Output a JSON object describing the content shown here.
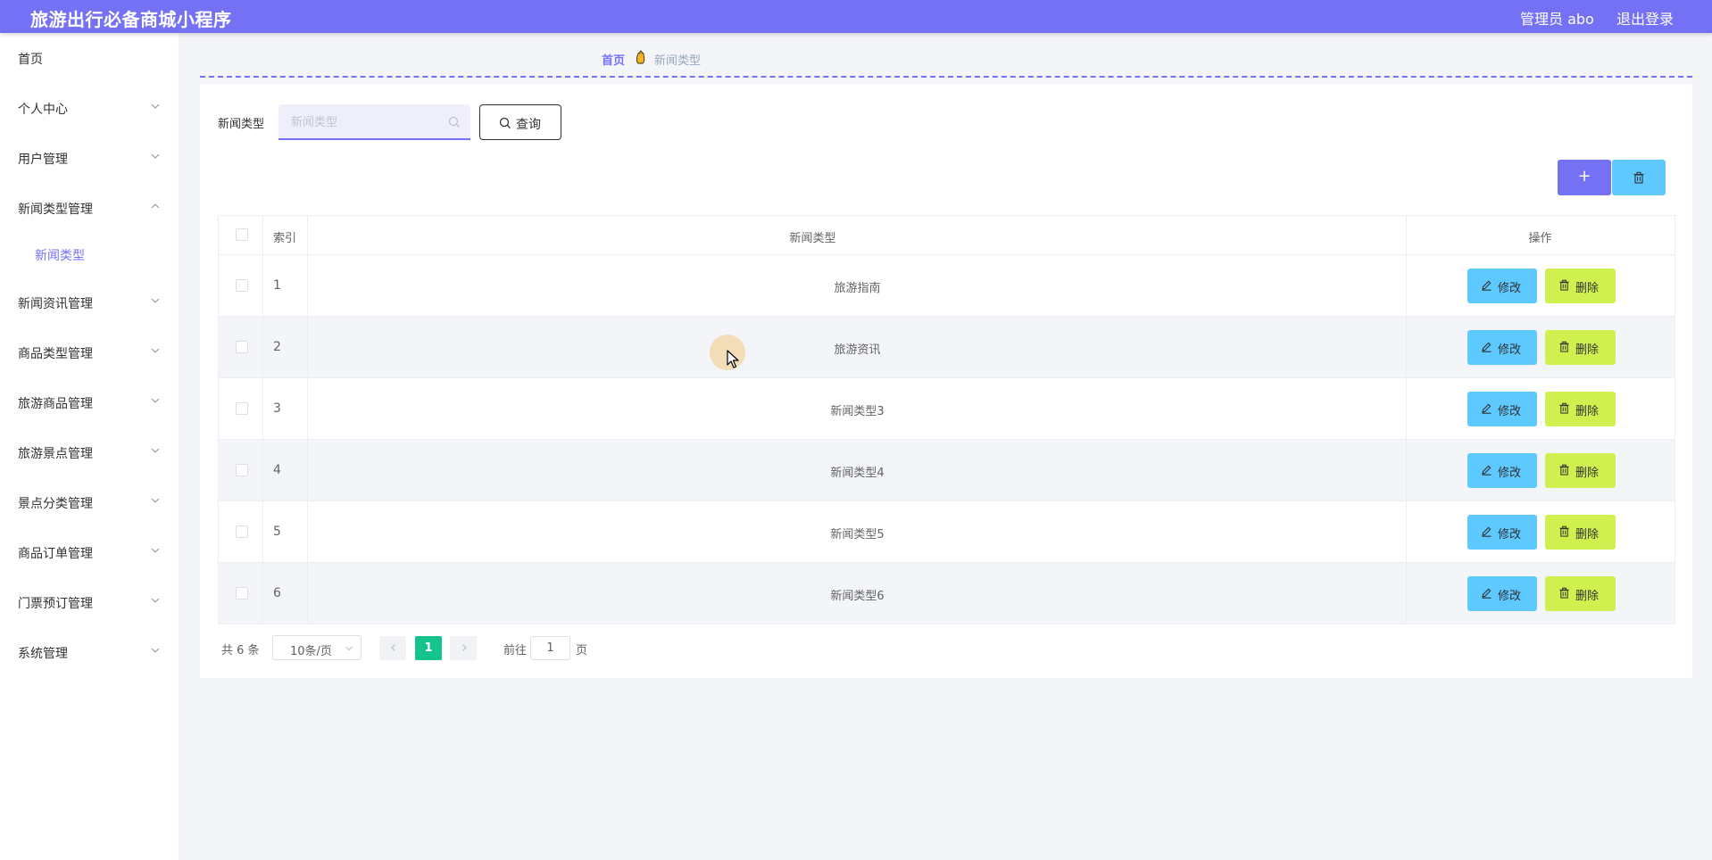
{
  "header": {
    "app_title": "旅游出行必备商城小程序",
    "user_label": "管理员 abo",
    "logout_label": "退出登录"
  },
  "sidebar": {
    "items": [
      {
        "label": "首页",
        "expanded": false,
        "has_arrow": false
      },
      {
        "label": "个人中心",
        "expanded": false,
        "has_arrow": true
      },
      {
        "label": "用户管理",
        "expanded": false,
        "has_arrow": true
      },
      {
        "label": "新闻类型管理",
        "expanded": true,
        "has_arrow": true
      },
      {
        "label": "新闻资讯管理",
        "expanded": false,
        "has_arrow": true
      },
      {
        "label": "商品类型管理",
        "expanded": false,
        "has_arrow": true
      },
      {
        "label": "旅游商品管理",
        "expanded": false,
        "has_arrow": true
      },
      {
        "label": "旅游景点管理",
        "expanded": false,
        "has_arrow": true
      },
      {
        "label": "景点分类管理",
        "expanded": false,
        "has_arrow": true
      },
      {
        "label": "商品订单管理",
        "expanded": false,
        "has_arrow": true
      },
      {
        "label": "门票预订管理",
        "expanded": false,
        "has_arrow": true
      },
      {
        "label": "系统管理",
        "expanded": false,
        "has_arrow": true
      }
    ],
    "submenu": {
      "label": "新闻类型",
      "active": true
    }
  },
  "breadcrumb": {
    "home": "首页",
    "current": "新闻类型",
    "icon": "hand-icon"
  },
  "search": {
    "label": "新闻类型",
    "placeholder": "新闻类型",
    "value": "",
    "button_label": "查询"
  },
  "toolbar": {
    "add_label": "+",
    "delete_icon": "trash-icon"
  },
  "table": {
    "headers": {
      "index": "索引",
      "type": "新闻类型",
      "actions": "操作"
    },
    "edit_label": "修改",
    "delete_label": "删除",
    "rows": [
      {
        "index": "1",
        "type": "旅游指南"
      },
      {
        "index": "2",
        "type": "旅游资讯"
      },
      {
        "index": "3",
        "type": "新闻类型3"
      },
      {
        "index": "4",
        "type": "新闻类型4"
      },
      {
        "index": "5",
        "type": "新闻类型5"
      },
      {
        "index": "6",
        "type": "新闻类型6"
      }
    ]
  },
  "pagination": {
    "total_text": "共 6 条",
    "page_size": "10条/页",
    "current_page": "1",
    "goto_label": "前往",
    "goto_value": "1",
    "page_suffix": "页"
  },
  "colors": {
    "primary": "#7471f5",
    "info": "#5ec9ff",
    "warning_lime": "#d0f050",
    "page_active": "#14c48c"
  }
}
